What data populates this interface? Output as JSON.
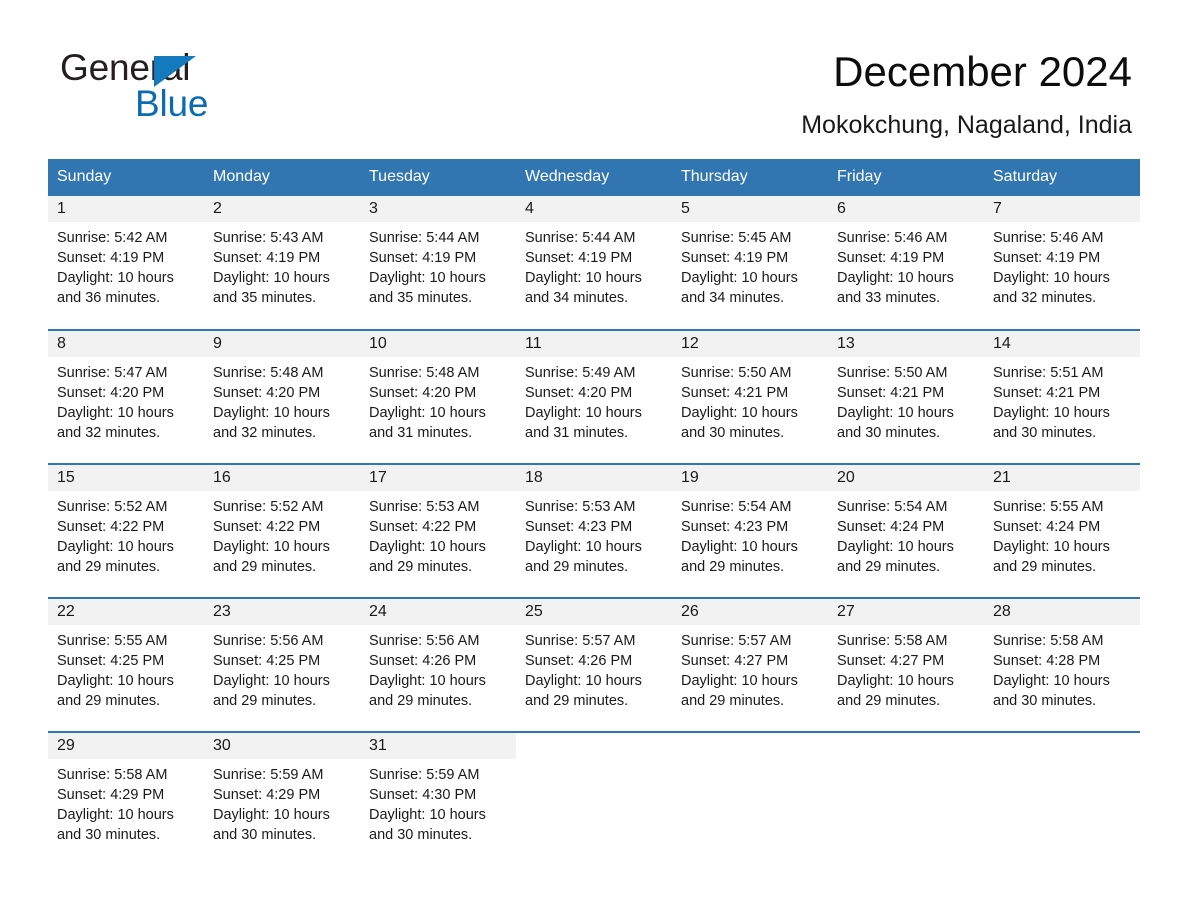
{
  "brand": {
    "logo_text_1": "General",
    "logo_text_2": "Blue",
    "triangle_color": "#1479bd",
    "blue_color": "#0b6cb4"
  },
  "header": {
    "title": "December 2024",
    "location": "Mokokchung, Nagaland, India"
  },
  "theme": {
    "header_row_bg": "#3276b1",
    "day_band_bg": "#f2f2f2",
    "separator": "#3276b1",
    "text": "#1a1a1a"
  },
  "calendar": {
    "weekday_headers": [
      "Sunday",
      "Monday",
      "Tuesday",
      "Wednesday",
      "Thursday",
      "Friday",
      "Saturday"
    ],
    "weeks": [
      [
        {
          "day": "1",
          "sunrise": "Sunrise: 5:42 AM",
          "sunset": "Sunset: 4:19 PM",
          "daylight_1": "Daylight: 10 hours",
          "daylight_2": "and 36 minutes."
        },
        {
          "day": "2",
          "sunrise": "Sunrise: 5:43 AM",
          "sunset": "Sunset: 4:19 PM",
          "daylight_1": "Daylight: 10 hours",
          "daylight_2": "and 35 minutes."
        },
        {
          "day": "3",
          "sunrise": "Sunrise: 5:44 AM",
          "sunset": "Sunset: 4:19 PM",
          "daylight_1": "Daylight: 10 hours",
          "daylight_2": "and 35 minutes."
        },
        {
          "day": "4",
          "sunrise": "Sunrise: 5:44 AM",
          "sunset": "Sunset: 4:19 PM",
          "daylight_1": "Daylight: 10 hours",
          "daylight_2": "and 34 minutes."
        },
        {
          "day": "5",
          "sunrise": "Sunrise: 5:45 AM",
          "sunset": "Sunset: 4:19 PM",
          "daylight_1": "Daylight: 10 hours",
          "daylight_2": "and 34 minutes."
        },
        {
          "day": "6",
          "sunrise": "Sunrise: 5:46 AM",
          "sunset": "Sunset: 4:19 PM",
          "daylight_1": "Daylight: 10 hours",
          "daylight_2": "and 33 minutes."
        },
        {
          "day": "7",
          "sunrise": "Sunrise: 5:46 AM",
          "sunset": "Sunset: 4:19 PM",
          "daylight_1": "Daylight: 10 hours",
          "daylight_2": "and 32 minutes."
        }
      ],
      [
        {
          "day": "8",
          "sunrise": "Sunrise: 5:47 AM",
          "sunset": "Sunset: 4:20 PM",
          "daylight_1": "Daylight: 10 hours",
          "daylight_2": "and 32 minutes."
        },
        {
          "day": "9",
          "sunrise": "Sunrise: 5:48 AM",
          "sunset": "Sunset: 4:20 PM",
          "daylight_1": "Daylight: 10 hours",
          "daylight_2": "and 32 minutes."
        },
        {
          "day": "10",
          "sunrise": "Sunrise: 5:48 AM",
          "sunset": "Sunset: 4:20 PM",
          "daylight_1": "Daylight: 10 hours",
          "daylight_2": "and 31 minutes."
        },
        {
          "day": "11",
          "sunrise": "Sunrise: 5:49 AM",
          "sunset": "Sunset: 4:20 PM",
          "daylight_1": "Daylight: 10 hours",
          "daylight_2": "and 31 minutes."
        },
        {
          "day": "12",
          "sunrise": "Sunrise: 5:50 AM",
          "sunset": "Sunset: 4:21 PM",
          "daylight_1": "Daylight: 10 hours",
          "daylight_2": "and 30 minutes."
        },
        {
          "day": "13",
          "sunrise": "Sunrise: 5:50 AM",
          "sunset": "Sunset: 4:21 PM",
          "daylight_1": "Daylight: 10 hours",
          "daylight_2": "and 30 minutes."
        },
        {
          "day": "14",
          "sunrise": "Sunrise: 5:51 AM",
          "sunset": "Sunset: 4:21 PM",
          "daylight_1": "Daylight: 10 hours",
          "daylight_2": "and 30 minutes."
        }
      ],
      [
        {
          "day": "15",
          "sunrise": "Sunrise: 5:52 AM",
          "sunset": "Sunset: 4:22 PM",
          "daylight_1": "Daylight: 10 hours",
          "daylight_2": "and 29 minutes."
        },
        {
          "day": "16",
          "sunrise": "Sunrise: 5:52 AM",
          "sunset": "Sunset: 4:22 PM",
          "daylight_1": "Daylight: 10 hours",
          "daylight_2": "and 29 minutes."
        },
        {
          "day": "17",
          "sunrise": "Sunrise: 5:53 AM",
          "sunset": "Sunset: 4:22 PM",
          "daylight_1": "Daylight: 10 hours",
          "daylight_2": "and 29 minutes."
        },
        {
          "day": "18",
          "sunrise": "Sunrise: 5:53 AM",
          "sunset": "Sunset: 4:23 PM",
          "daylight_1": "Daylight: 10 hours",
          "daylight_2": "and 29 minutes."
        },
        {
          "day": "19",
          "sunrise": "Sunrise: 5:54 AM",
          "sunset": "Sunset: 4:23 PM",
          "daylight_1": "Daylight: 10 hours",
          "daylight_2": "and 29 minutes."
        },
        {
          "day": "20",
          "sunrise": "Sunrise: 5:54 AM",
          "sunset": "Sunset: 4:24 PM",
          "daylight_1": "Daylight: 10 hours",
          "daylight_2": "and 29 minutes."
        },
        {
          "day": "21",
          "sunrise": "Sunrise: 5:55 AM",
          "sunset": "Sunset: 4:24 PM",
          "daylight_1": "Daylight: 10 hours",
          "daylight_2": "and 29 minutes."
        }
      ],
      [
        {
          "day": "22",
          "sunrise": "Sunrise: 5:55 AM",
          "sunset": "Sunset: 4:25 PM",
          "daylight_1": "Daylight: 10 hours",
          "daylight_2": "and 29 minutes."
        },
        {
          "day": "23",
          "sunrise": "Sunrise: 5:56 AM",
          "sunset": "Sunset: 4:25 PM",
          "daylight_1": "Daylight: 10 hours",
          "daylight_2": "and 29 minutes."
        },
        {
          "day": "24",
          "sunrise": "Sunrise: 5:56 AM",
          "sunset": "Sunset: 4:26 PM",
          "daylight_1": "Daylight: 10 hours",
          "daylight_2": "and 29 minutes."
        },
        {
          "day": "25",
          "sunrise": "Sunrise: 5:57 AM",
          "sunset": "Sunset: 4:26 PM",
          "daylight_1": "Daylight: 10 hours",
          "daylight_2": "and 29 minutes."
        },
        {
          "day": "26",
          "sunrise": "Sunrise: 5:57 AM",
          "sunset": "Sunset: 4:27 PM",
          "daylight_1": "Daylight: 10 hours",
          "daylight_2": "and 29 minutes."
        },
        {
          "day": "27",
          "sunrise": "Sunrise: 5:58 AM",
          "sunset": "Sunset: 4:27 PM",
          "daylight_1": "Daylight: 10 hours",
          "daylight_2": "and 29 minutes."
        },
        {
          "day": "28",
          "sunrise": "Sunrise: 5:58 AM",
          "sunset": "Sunset: 4:28 PM",
          "daylight_1": "Daylight: 10 hours",
          "daylight_2": "and 30 minutes."
        }
      ],
      [
        {
          "day": "29",
          "sunrise": "Sunrise: 5:58 AM",
          "sunset": "Sunset: 4:29 PM",
          "daylight_1": "Daylight: 10 hours",
          "daylight_2": "and 30 minutes."
        },
        {
          "day": "30",
          "sunrise": "Sunrise: 5:59 AM",
          "sunset": "Sunset: 4:29 PM",
          "daylight_1": "Daylight: 10 hours",
          "daylight_2": "and 30 minutes."
        },
        {
          "day": "31",
          "sunrise": "Sunrise: 5:59 AM",
          "sunset": "Sunset: 4:30 PM",
          "daylight_1": "Daylight: 10 hours",
          "daylight_2": "and 30 minutes."
        },
        {
          "day": "",
          "sunrise": "",
          "sunset": "",
          "daylight_1": "",
          "daylight_2": ""
        },
        {
          "day": "",
          "sunrise": "",
          "sunset": "",
          "daylight_1": "",
          "daylight_2": ""
        },
        {
          "day": "",
          "sunrise": "",
          "sunset": "",
          "daylight_1": "",
          "daylight_2": ""
        },
        {
          "day": "",
          "sunrise": "",
          "sunset": "",
          "daylight_1": "",
          "daylight_2": ""
        }
      ]
    ]
  }
}
